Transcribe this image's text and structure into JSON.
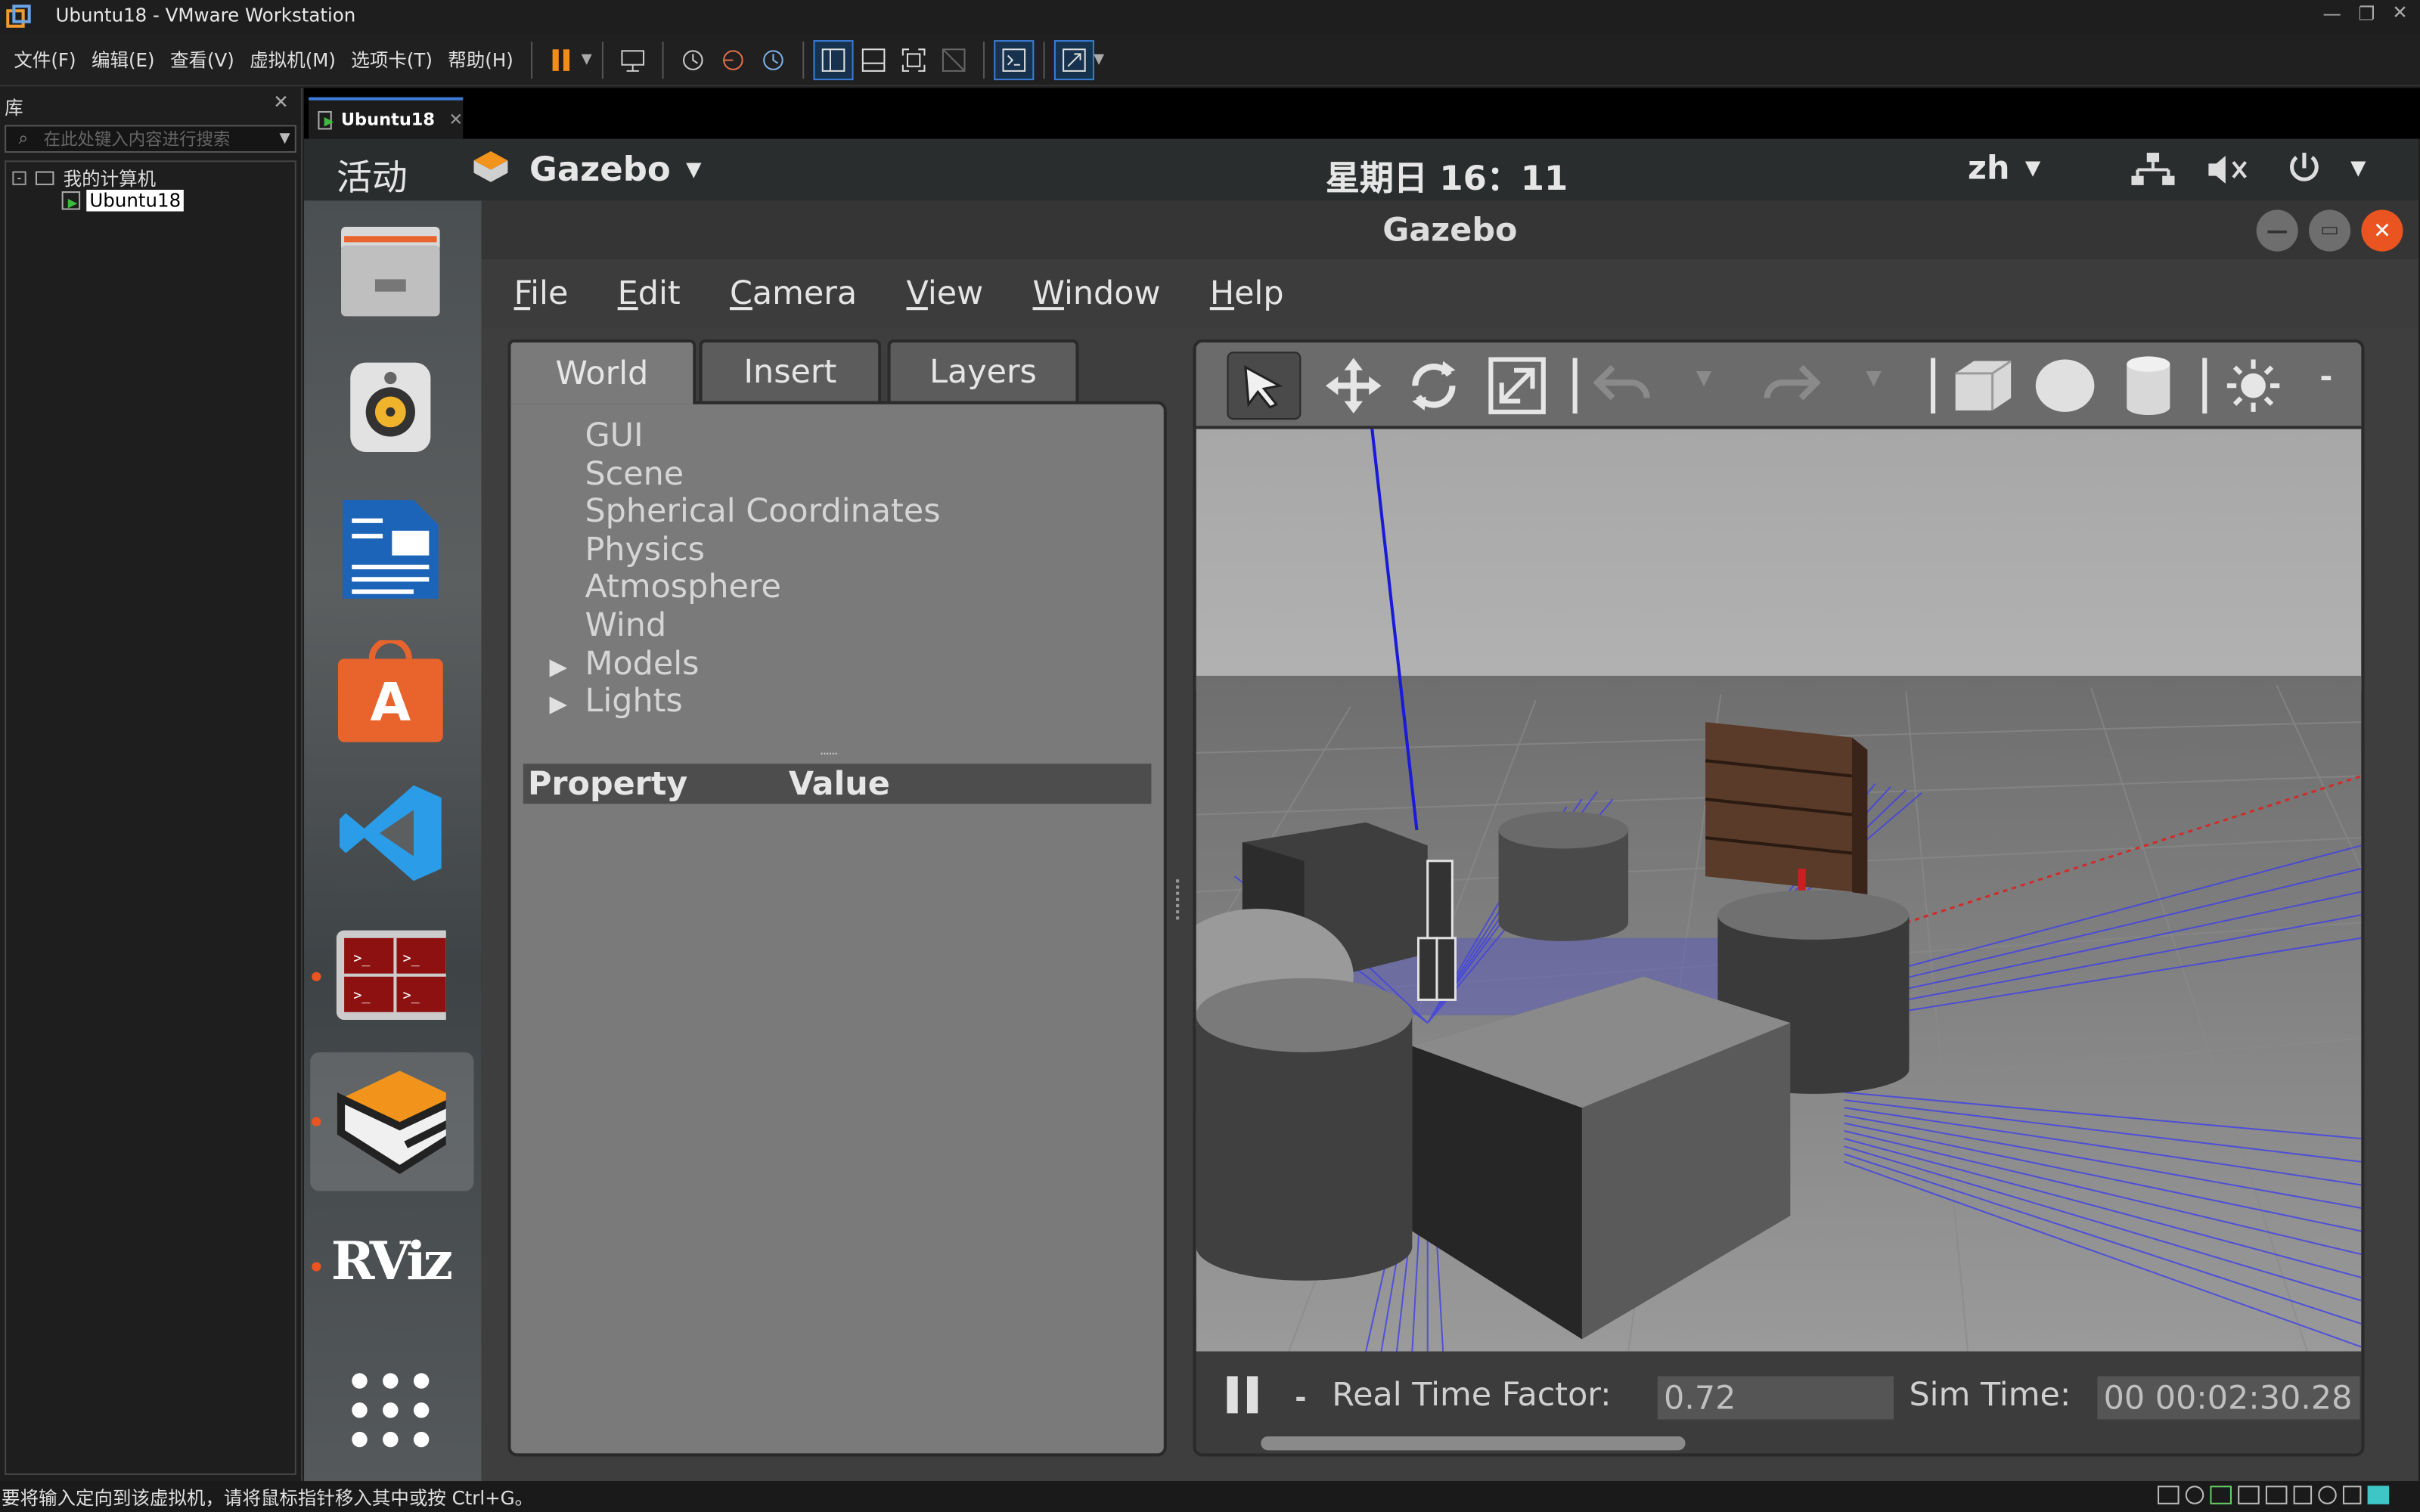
{
  "window": {
    "title": "Ubuntu18 - VMware Workstation"
  },
  "vmware_menu": [
    "文件(F)",
    "编辑(E)",
    "查看(V)",
    "虚拟机(M)",
    "选项卡(T)",
    "帮助(H)"
  ],
  "library": {
    "title": "库",
    "search_placeholder": "在此处键入内容进行搜索",
    "root": "我的计算机",
    "vm": "Ubuntu18"
  },
  "vm_tab": {
    "label": "Ubuntu18"
  },
  "status_bar": {
    "message": "要将输入定向到该虚拟机，请将鼠标指针移入其中或按 Ctrl+G。"
  },
  "ubuntu": {
    "activities": "活动",
    "app_name": "Gazebo",
    "clock": "星期日 16：11",
    "lang": "zh"
  },
  "dock": [
    {
      "name": "files-icon"
    },
    {
      "name": "rhythmbox-icon"
    },
    {
      "name": "writer-icon"
    },
    {
      "name": "software-icon"
    },
    {
      "name": "vscode-icon"
    },
    {
      "name": "terminator-icon"
    },
    {
      "name": "gazebo-icon"
    },
    {
      "name": "rviz-icon",
      "text": "RViz"
    },
    {
      "name": "app-grid-icon"
    }
  ],
  "gazebo": {
    "title": "Gazebo",
    "menu": [
      {
        "first": "F",
        "rest": "ile"
      },
      {
        "first": "E",
        "rest": "dit"
      },
      {
        "first": "C",
        "rest": "amera"
      },
      {
        "first": "V",
        "rest": "iew"
      },
      {
        "first": "W",
        "rest": "indow"
      },
      {
        "first": "H",
        "rest": "elp"
      }
    ],
    "tabs": [
      "World",
      "Insert",
      "Layers"
    ],
    "tree": [
      "GUI",
      "Scene",
      "Spherical Coordinates",
      "Physics",
      "Atmosphere",
      "Wind",
      "Models",
      "Lights"
    ],
    "property_header": "Property",
    "value_header": "Value",
    "splitter": "......",
    "dash": "-",
    "real_time_label": "Real Time Factor:",
    "real_time_value": "0.72",
    "sim_time_label": "Sim Time:",
    "sim_time_value": "00 00:02:30.28"
  }
}
